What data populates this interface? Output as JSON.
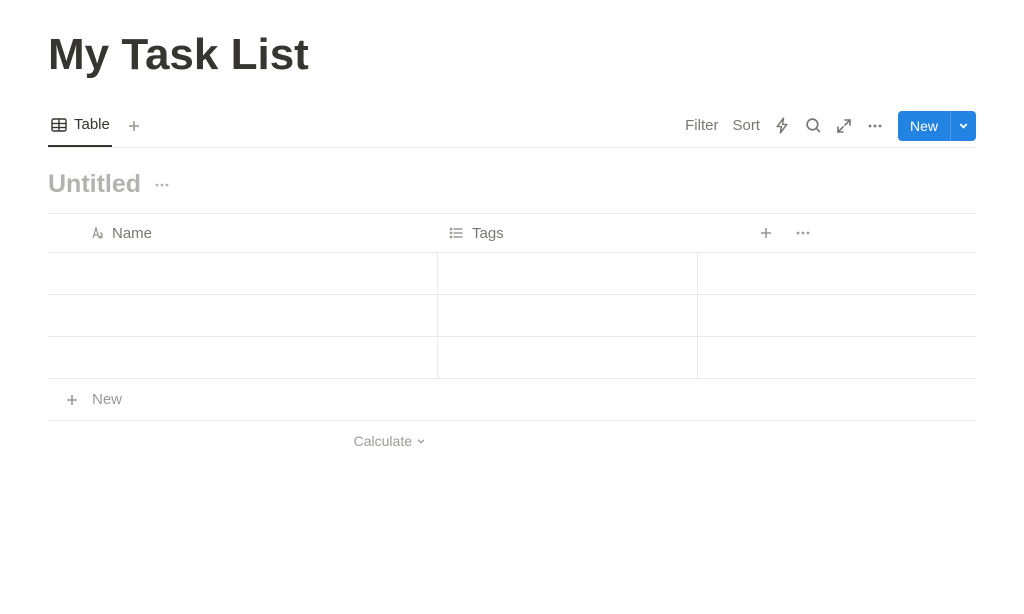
{
  "page": {
    "title": "My Task List"
  },
  "viewBar": {
    "tab": {
      "label": "Table"
    },
    "actions": {
      "filter": "Filter",
      "sort": "Sort",
      "newButton": "New"
    }
  },
  "database": {
    "title": "Untitled",
    "columns": {
      "name": "Name",
      "tags": "Tags"
    },
    "addRow": "New",
    "calculate": "Calculate"
  }
}
